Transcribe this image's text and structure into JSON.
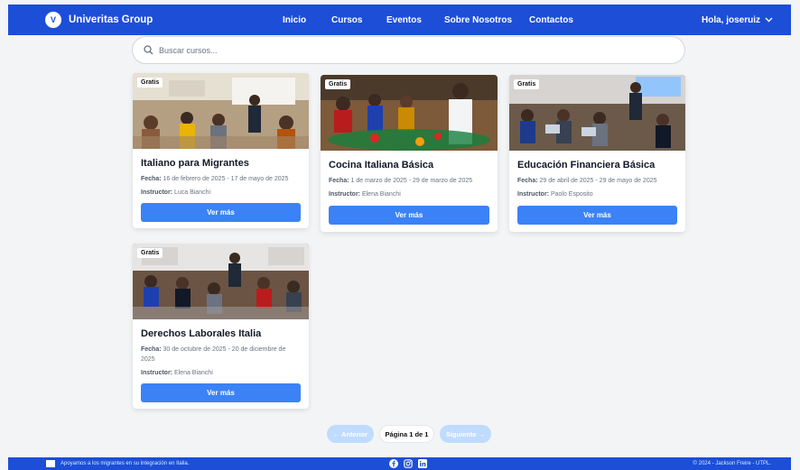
{
  "navbar": {
    "brand": "Univeritas Group",
    "logo_text": "V",
    "links": [
      "Inicio",
      "Cursos",
      "Eventos",
      "Sobre Nosotros",
      "Contactos"
    ],
    "user": "Hola, joseruiz"
  },
  "search": {
    "placeholder": "Buscar cursos..."
  },
  "courses": [
    {
      "badge": "Gratis",
      "title": "Italiano para Migrantes",
      "fecha_label": "Fecha:",
      "fecha": "16 de febrero de 2025 - 17 de mayo de 2025",
      "instructor_label": "Instructor:",
      "instructor": "Luca Bianchi",
      "button": "Ver más"
    },
    {
      "badge": "Gratis",
      "title": "Cocina Italiana Básica",
      "fecha_label": "Fecha:",
      "fecha": "1 de marzo de 2025 - 29 de marzo de 2025",
      "instructor_label": "Instructor:",
      "instructor": "Elena Bianchi",
      "button": "Ver más"
    },
    {
      "badge": "Gratis",
      "title": "Educación Financiera Básica",
      "fecha_label": "Fecha:",
      "fecha": "29 de abril de 2025 - 29 de mayo de 2025",
      "instructor_label": "Instructor:",
      "instructor": "Paolo Esposito",
      "button": "Ver más"
    },
    {
      "badge": "Gratis",
      "title": "Derechos Laborales Italia",
      "fecha_label": "Fecha:",
      "fecha": "30 de octubre de 2025 - 20 de diciembre de 2025",
      "instructor_label": "Instructor:",
      "instructor": "Elena Bianchi",
      "button": "Ver más"
    }
  ],
  "pagination": {
    "prev": "← Anterior",
    "info": "Página 1 de 1",
    "next": "Siguiente →"
  },
  "footer": {
    "tagline": "Apoyamos a los migrantes en su integración en Italia.",
    "copyright": "© 2024 - Jackson Freire - UTPL.",
    "social": [
      "facebook-icon",
      "instagram-icon",
      "linkedin-icon"
    ]
  },
  "colors": {
    "primary": "#1d4ed8",
    "button": "#3b82f6"
  }
}
